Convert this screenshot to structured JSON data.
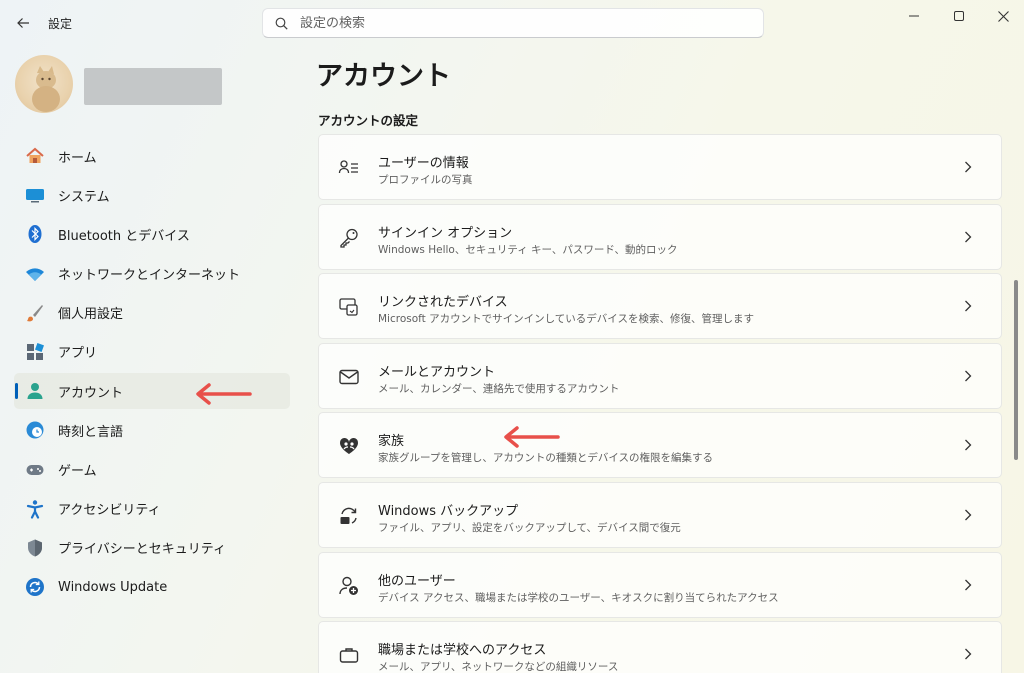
{
  "window": {
    "title": "設定",
    "minimize": "minimize-icon",
    "maximize": "maximize-icon",
    "close": "close-icon"
  },
  "search": {
    "placeholder": "設定の検索"
  },
  "sidebar": {
    "items": [
      {
        "label": "ホーム",
        "icon": "home-icon"
      },
      {
        "label": "システム",
        "icon": "system-icon"
      },
      {
        "label": "Bluetooth とデバイス",
        "icon": "bluetooth-icon"
      },
      {
        "label": "ネットワークとインターネット",
        "icon": "wifi-icon"
      },
      {
        "label": "個人用設定",
        "icon": "brush-icon"
      },
      {
        "label": "アプリ",
        "icon": "apps-icon"
      },
      {
        "label": "アカウント",
        "icon": "account-icon",
        "active": true
      },
      {
        "label": "時刻と言語",
        "icon": "time-language-icon"
      },
      {
        "label": "ゲーム",
        "icon": "gamepad-icon"
      },
      {
        "label": "アクセシビリティ",
        "icon": "accessibility-icon"
      },
      {
        "label": "プライバシーとセキュリティ",
        "icon": "shield-icon"
      },
      {
        "label": "Windows Update",
        "icon": "update-icon"
      }
    ]
  },
  "main": {
    "title": "アカウント",
    "section": "アカウントの設定",
    "cards": [
      {
        "title": "ユーザーの情報",
        "subtitle": "プロファイルの写真",
        "icon": "user-info-icon"
      },
      {
        "title": "サインイン オプション",
        "subtitle": "Windows Hello、セキュリティ キー、パスワード、動的ロック",
        "icon": "key-icon"
      },
      {
        "title": "リンクされたデバイス",
        "subtitle": "Microsoft アカウントでサインインしているデバイスを検索、修復、管理します",
        "icon": "linked-devices-icon"
      },
      {
        "title": "メールとアカウント",
        "subtitle": "メール、カレンダー、連絡先で使用するアカウント",
        "icon": "mail-icon"
      },
      {
        "title": "家族",
        "subtitle": "家族グループを管理し、アカウントの種類とデバイスの権限を編集する",
        "icon": "family-heart-icon"
      },
      {
        "title": "Windows バックアップ",
        "subtitle": "ファイル、アプリ、設定をバックアップして、デバイス間で復元",
        "icon": "backup-icon"
      },
      {
        "title": "他のユーザー",
        "subtitle": "デバイス アクセス、職場または学校のユーザー、キオスクに割り当てられたアクセス",
        "icon": "add-user-icon"
      },
      {
        "title": "職場または学校へのアクセス",
        "subtitle": "メール、アプリ、ネットワークなどの組織リソース",
        "icon": "briefcase-icon"
      }
    ]
  },
  "colors": {
    "accent": "#005fb8",
    "annotation_arrow": "#e8504a"
  }
}
